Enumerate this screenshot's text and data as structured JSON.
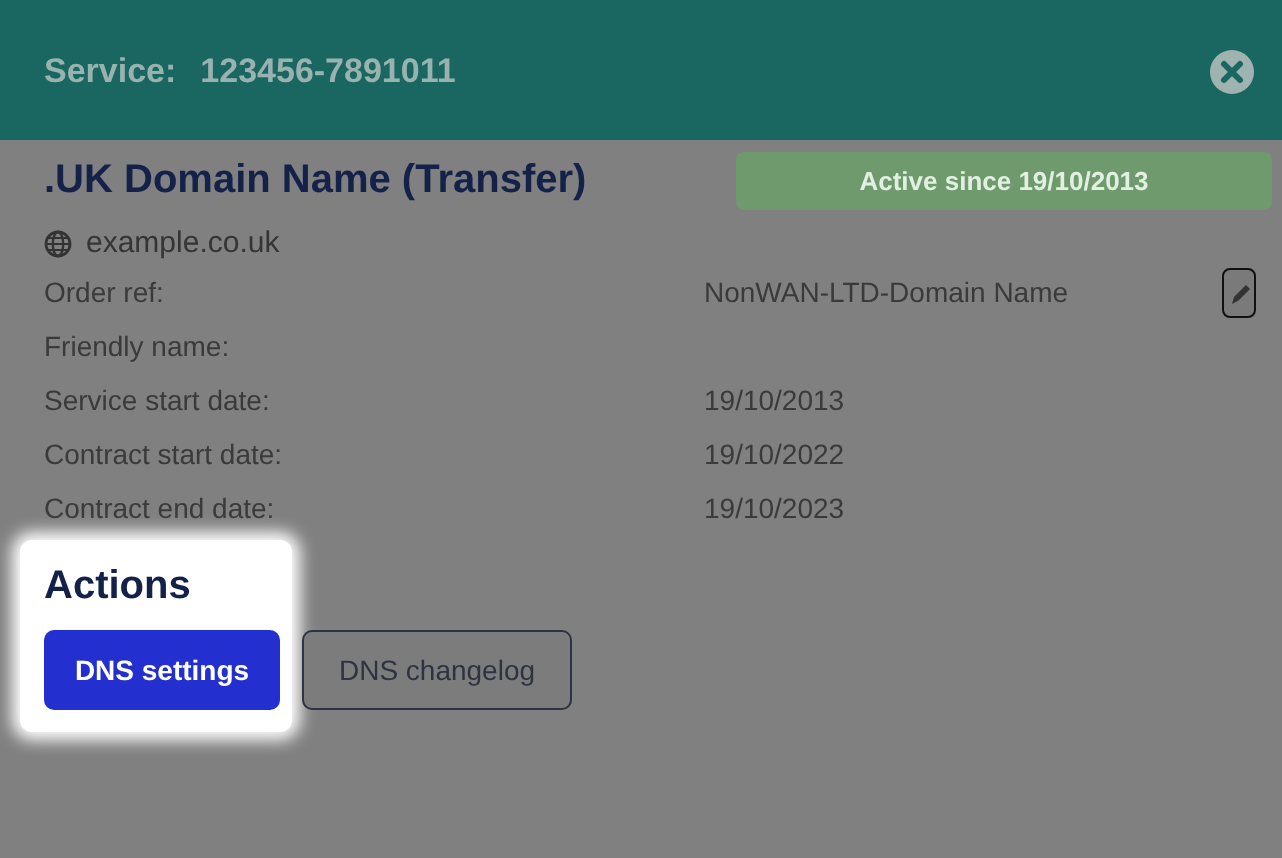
{
  "header": {
    "label": "Service:",
    "service_id": "123456-7891011"
  },
  "service": {
    "name": ".UK Domain Name (Transfer)",
    "status": "Active since 19/10/2013",
    "domain": "example.co.uk"
  },
  "details": [
    {
      "label": "Order ref:",
      "value": "NonWAN-LTD-Domain Name",
      "editable": true
    },
    {
      "label": "Friendly name:",
      "editable": false
    },
    {
      "label": "Service start date:",
      "value": "19/10/2013",
      "editable": false
    },
    {
      "label": "Contract start date:",
      "value": "19/10/2022",
      "editable": false
    },
    {
      "label": "Contract end date:",
      "value": "19/10/2023",
      "editable": false
    }
  ],
  "actions": {
    "title": "Actions",
    "spotlight": true,
    "buttons": [
      {
        "label": "DNS settings",
        "kind": "primary"
      },
      {
        "label": "DNS changelog",
        "kind": "secondary"
      }
    ]
  }
}
